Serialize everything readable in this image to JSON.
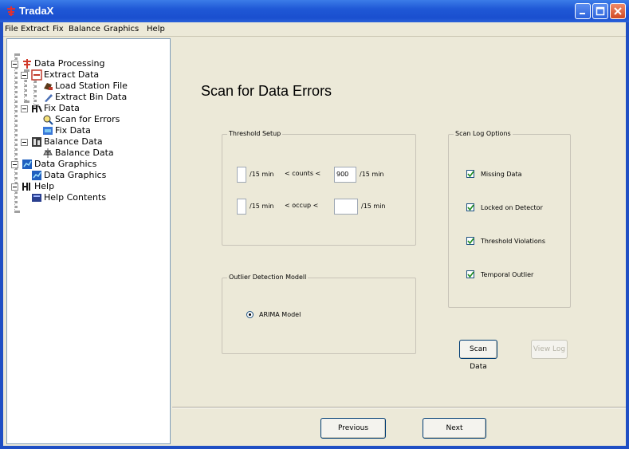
{
  "window": {
    "title": "TradaX"
  },
  "menu": [
    "File",
    "Extract",
    "Fix",
    "Balance",
    "Graphics",
    "Help"
  ],
  "tree": {
    "data_processing": "Data Processing",
    "extract_data": "Extract Data",
    "load_station_file": "Load Station File",
    "extract_bin_data": "Extract Bin Data",
    "fix_data": "Fix Data",
    "scan_for_errors": "Scan for Errors",
    "fix_data_leaf": "Fix Data",
    "balance_data": "Balance Data",
    "balance_data_leaf": "Balance Data",
    "data_graphics": "Data Graphics",
    "data_graphics_leaf": "Data Graphics",
    "help": "Help",
    "help_contents": "Help Contents"
  },
  "page": {
    "title": "Scan for Data Errors",
    "threshold": {
      "title": "Threshold Setup",
      "counts_min": "",
      "counts_max": "900",
      "occup_min": "",
      "occup_max": "",
      "per15": "/15 min",
      "counts_label": "< counts <",
      "occup_label": "< occup <"
    },
    "scan_log": {
      "title": "Scan Log Options",
      "options": [
        {
          "label": "Missing Data",
          "checked": true
        },
        {
          "label": "Locked on Detector",
          "checked": true
        },
        {
          "label": "Threshold Violations",
          "checked": true
        },
        {
          "label": "Temporal Outlier",
          "checked": true
        }
      ]
    },
    "outlier": {
      "title": "Outlier Detection Modell",
      "model": "ARIMA  Model"
    },
    "buttons": {
      "scan_data": "Scan Data",
      "view_log": "View Log",
      "previous": "Previous",
      "next": "Next"
    }
  }
}
